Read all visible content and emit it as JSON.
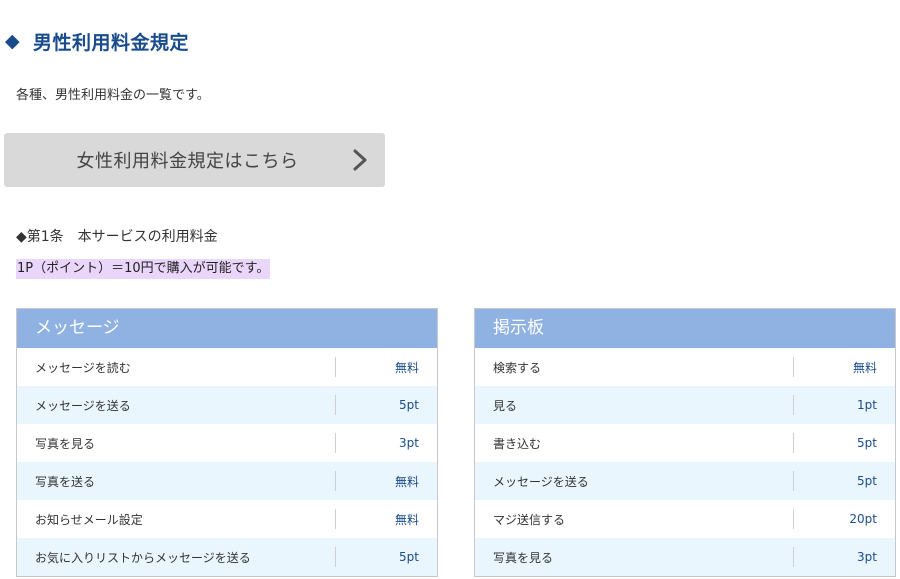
{
  "heading": {
    "title": "男性利用料金規定",
    "marker": "◆"
  },
  "intro": "各種、男性利用料金の一覧です。",
  "female_link": {
    "label": "女性利用料金規定はこちら",
    "icon": "chevron-right-icon"
  },
  "article": {
    "title": "◆第1条　本サービスの利用料金",
    "note": "1P（ポイント）＝10円で購入が可能です。"
  },
  "colors": {
    "heading": "#1a4c8b",
    "table_header": "#8fb2e3",
    "row_alt": "#eaf6fd",
    "note_highlight": "#ead6fa",
    "button_bg": "#d9d9d9"
  },
  "tables": {
    "message": {
      "title": "メッセージ",
      "rows": [
        {
          "name": "メッセージを読む",
          "price": "無料"
        },
        {
          "name": "メッセージを送る",
          "price": "5pt"
        },
        {
          "name": "写真を見る",
          "price": "3pt"
        },
        {
          "name": "写真を送る",
          "price": "無料"
        },
        {
          "name": "お知らせメール設定",
          "price": "無料"
        },
        {
          "name": "お気に入りリストからメッセージを送る",
          "price": "5pt"
        }
      ]
    },
    "board": {
      "title": "掲示板",
      "rows": [
        {
          "name": "検索する",
          "price": "無料"
        },
        {
          "name": "見る",
          "price": "1pt"
        },
        {
          "name": "書き込む",
          "price": "5pt"
        },
        {
          "name": "メッセージを送る",
          "price": "5pt"
        },
        {
          "name": "マジ送信する",
          "price": "20pt"
        },
        {
          "name": "写真を見る",
          "price": "3pt"
        }
      ]
    }
  }
}
